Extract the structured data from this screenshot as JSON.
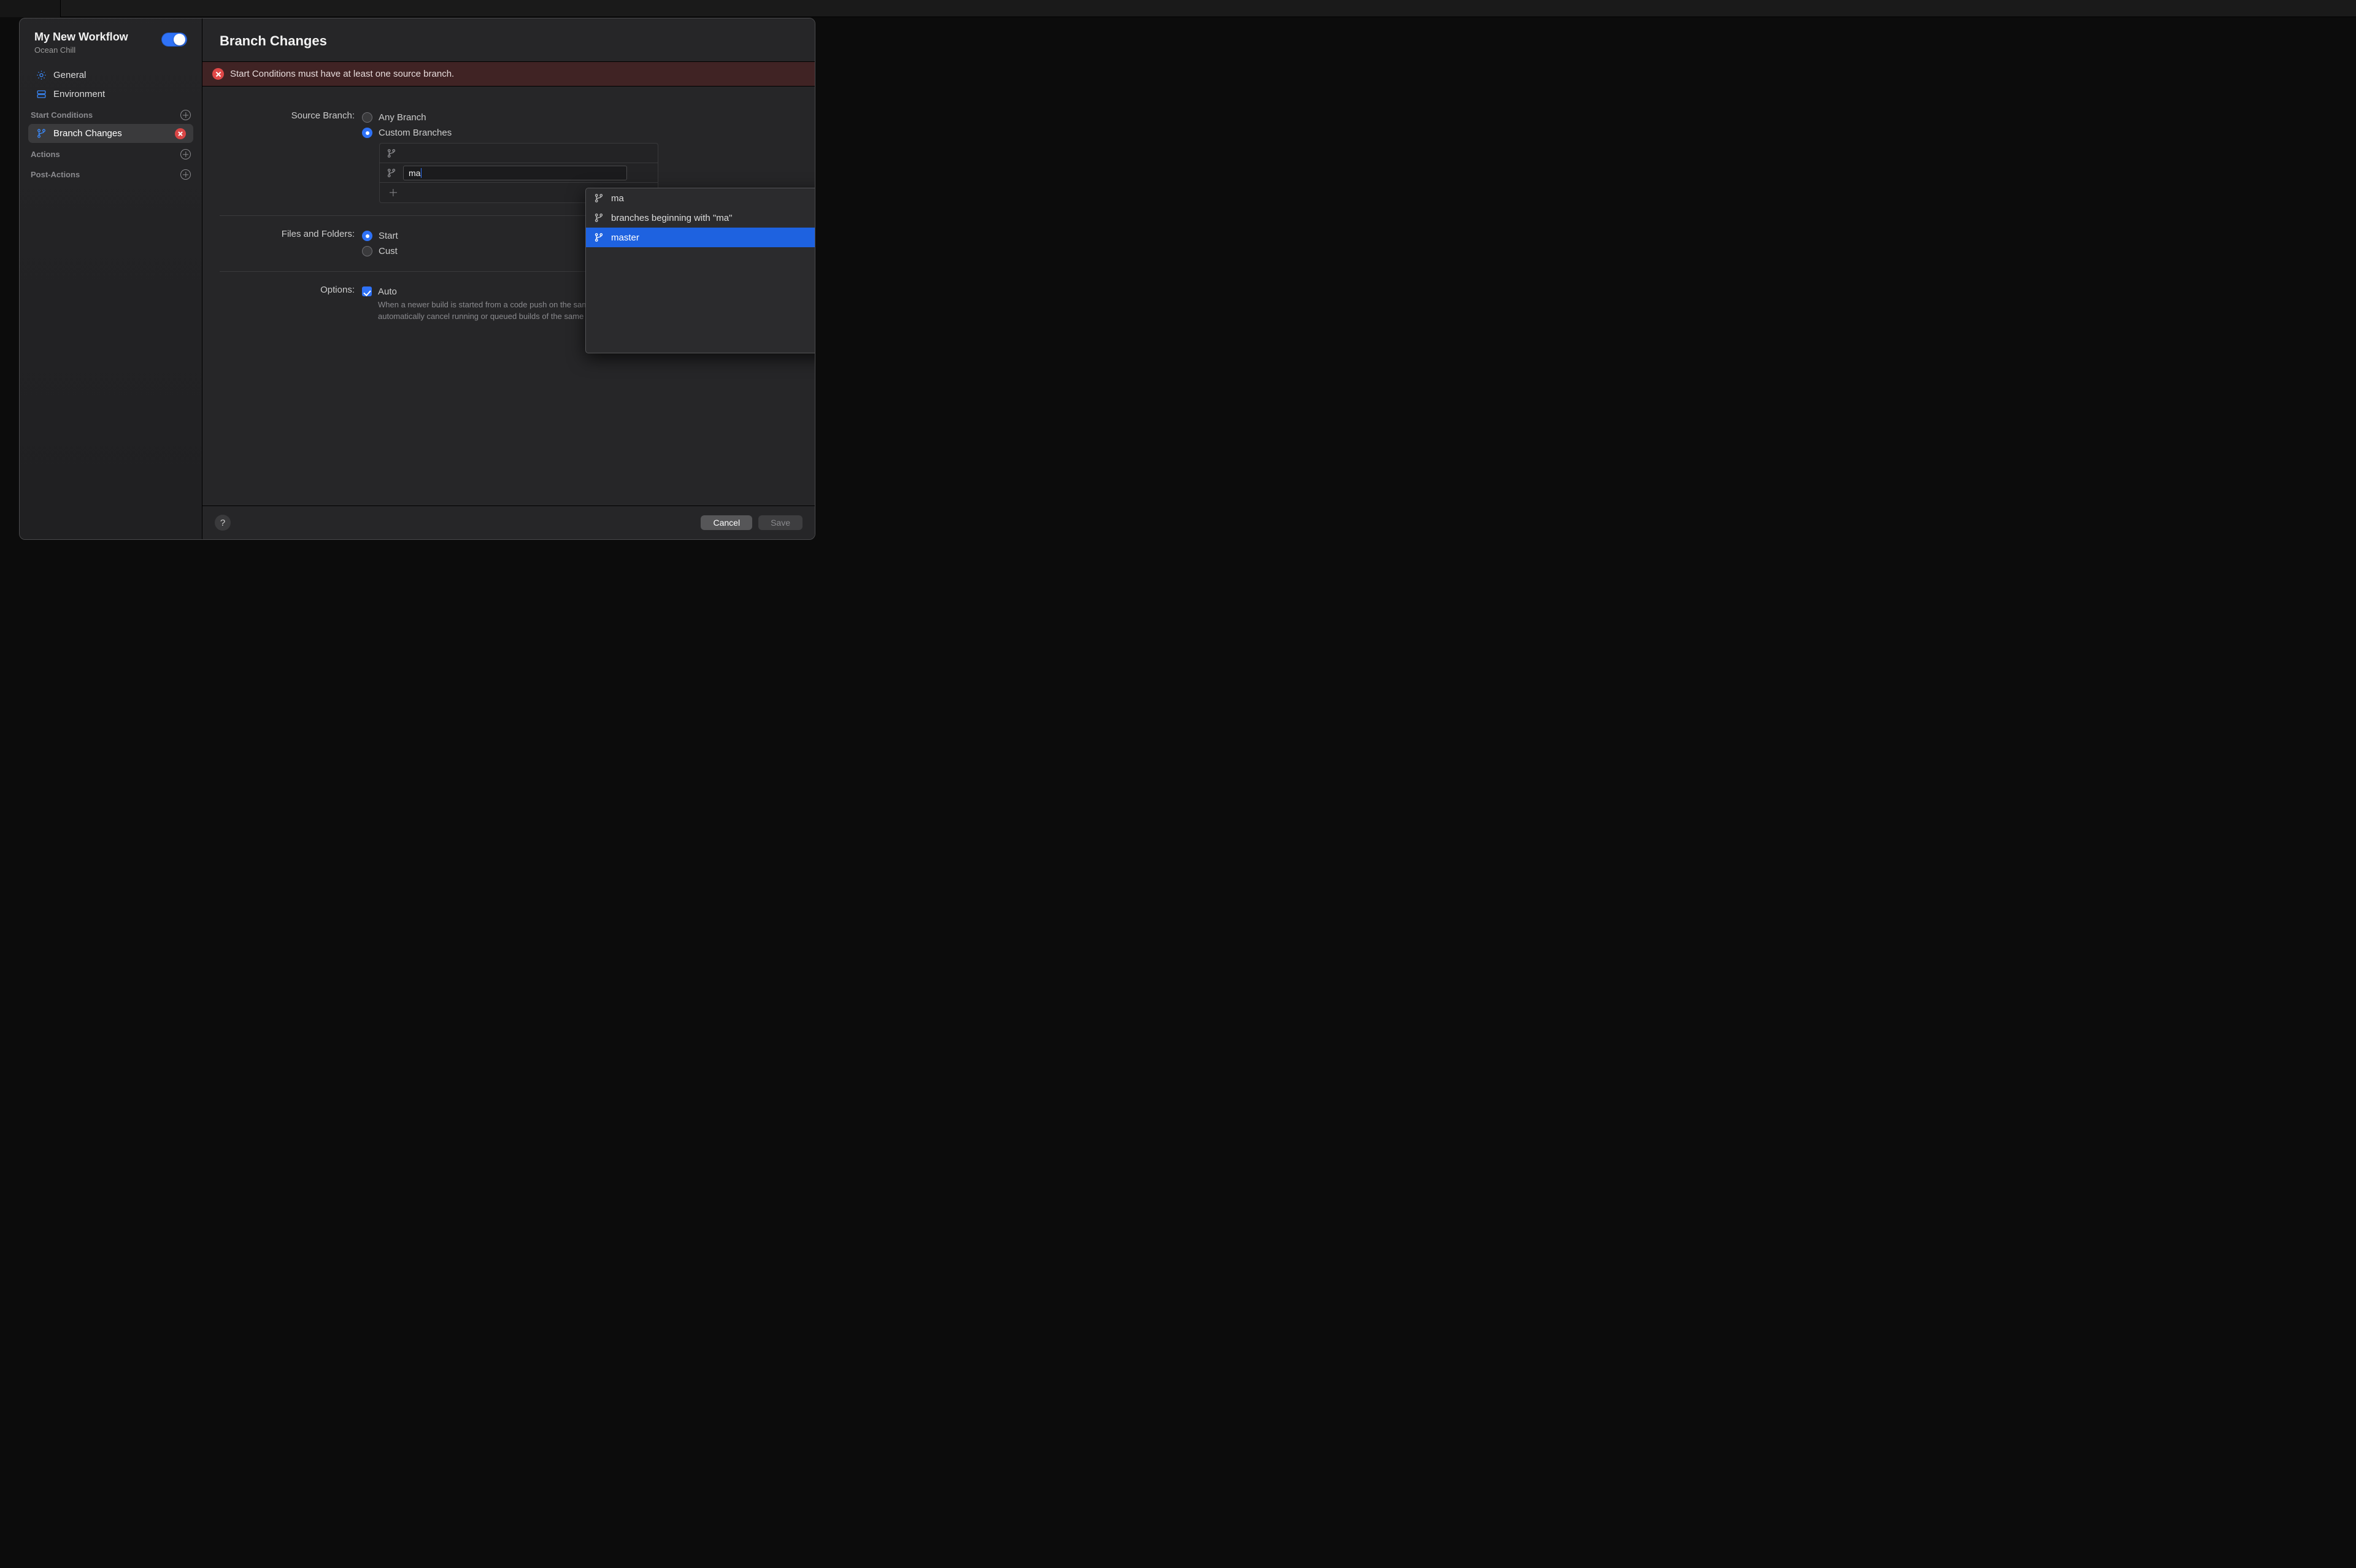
{
  "sidebar": {
    "title": "My New Workflow",
    "subtitle": "Ocean Chill",
    "items": {
      "general": "General",
      "environment": "Environment"
    },
    "sections": {
      "start_conditions": "Start Conditions",
      "branch_changes": "Branch Changes",
      "actions": "Actions",
      "post_actions": "Post-Actions"
    }
  },
  "main": {
    "title": "Branch Changes",
    "error": "Start Conditions must have at least one source branch.",
    "source_branch": {
      "label": "Source Branch:",
      "any": "Any Branch",
      "custom": "Custom Branches",
      "input_value": "ma"
    },
    "dropdown": {
      "opt_ma": "ma",
      "opt_beginning": "branches beginning with \"ma\"",
      "opt_master": "master"
    },
    "files_folders": {
      "label": "Files and Folders:",
      "start": "Start",
      "custom_prefix": "Cust"
    },
    "options": {
      "label": "Options:",
      "auto_prefix": "Auto",
      "description": "When a newer build is started from a code push on the same branch using this start condition, automatically cancel running or queued builds of the same kind."
    }
  },
  "footer": {
    "help": "?",
    "cancel": "Cancel",
    "save": "Save"
  }
}
